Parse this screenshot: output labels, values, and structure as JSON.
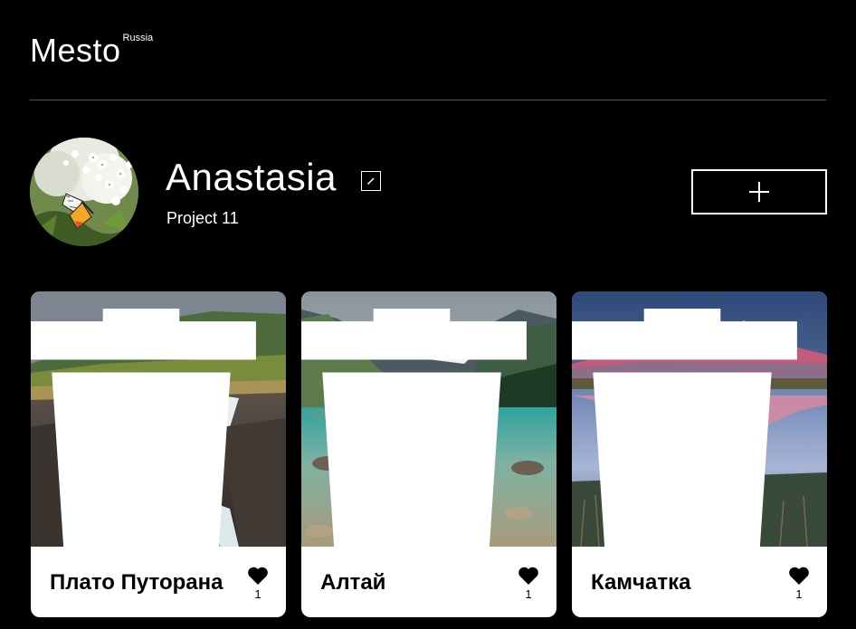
{
  "header": {
    "logo": "Mesto",
    "logo_sub": "Russia"
  },
  "profile": {
    "name": "Anastasia",
    "about": "Project 11",
    "edit_icon": "pencil-icon",
    "add_icon": "plus-icon"
  },
  "cards": [
    {
      "title": "Плато Путорана",
      "likes": "1",
      "image": "waterfall-plateau"
    },
    {
      "title": "Алтай",
      "likes": "1",
      "image": "mountain-lake"
    },
    {
      "title": "Камчатка",
      "likes": "1",
      "image": "volcano-reflection"
    }
  ],
  "colors": {
    "background": "#000000",
    "card": "#ffffff",
    "divider": "#545454"
  }
}
